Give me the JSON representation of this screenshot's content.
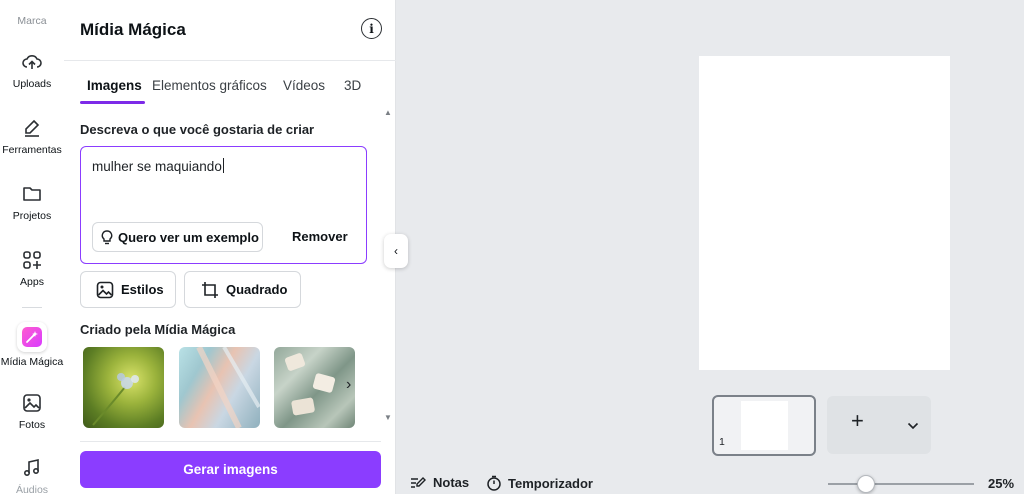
{
  "rail": {
    "top_label": "Marca",
    "items": [
      {
        "label": "Uploads",
        "icon": "upload-cloud-icon"
      },
      {
        "label": "Ferramentas",
        "icon": "pen-tool-icon"
      },
      {
        "label": "Projetos",
        "icon": "folder-icon"
      },
      {
        "label": "Apps",
        "icon": "apps-grid-icon"
      },
      {
        "label": "Mídia Mágica",
        "icon": "magic-media-icon"
      },
      {
        "label": "Fotos",
        "icon": "image-icon"
      },
      {
        "label": "Áudios",
        "icon": "music-note-icon"
      }
    ],
    "active_color": "#ff4fd8"
  },
  "panel": {
    "title": "Mídia Mágica",
    "tabs": [
      "Imagens",
      "Elementos gráficos",
      "Vídeos",
      "3D"
    ],
    "active_tab": "Imagens",
    "prompt_label": "Descreva o que você gostaria de criar",
    "prompt_value": "mulher se maquiando",
    "example_button": "Quero ver um exemplo",
    "remove_button": "Remover",
    "styles_button": "Estilos",
    "aspect_button": "Quadrado",
    "created_label": "Criado pela Mídia Mágica",
    "generate_button": "Gerar imagens",
    "accent_color": "#8b3dff"
  },
  "canvas": {
    "page_number": "1"
  },
  "footer": {
    "notes": "Notas",
    "timer": "Temporizador",
    "zoom": "25%",
    "zoom_level": 0.25
  }
}
